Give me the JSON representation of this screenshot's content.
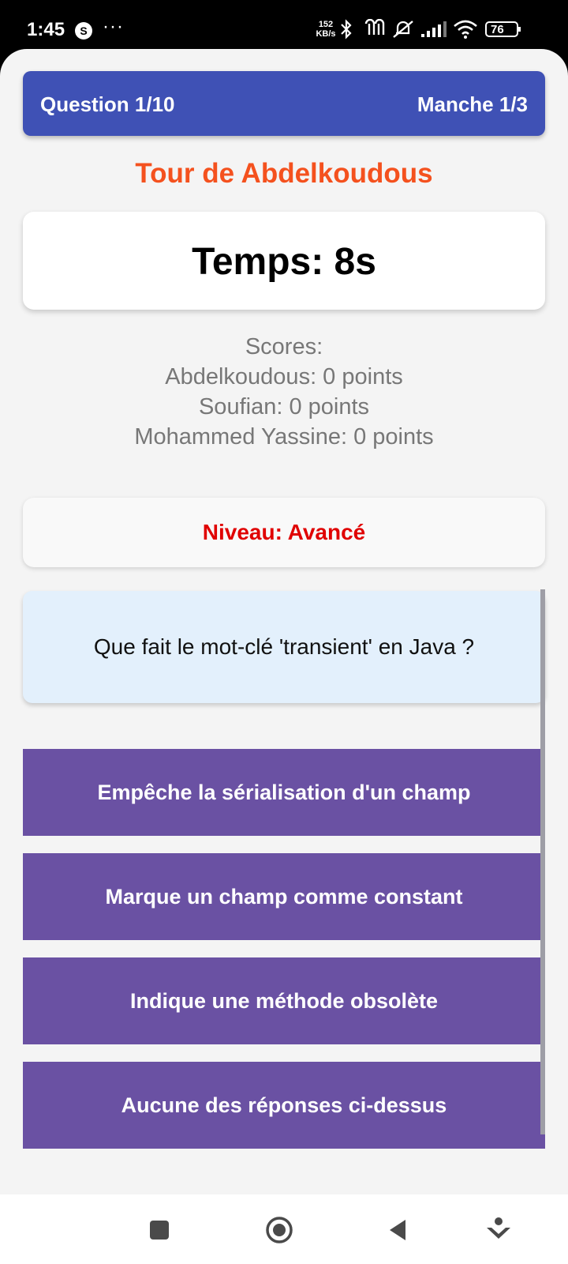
{
  "status_bar": {
    "time": "1:45",
    "app_icon_letter": "S",
    "more": "···",
    "net_speed_value": "152",
    "net_speed_unit": "KB/s",
    "battery": "76"
  },
  "header": {
    "question_counter": "Question 1/10",
    "round_counter": "Manche 1/3",
    "color": "#3f51b5"
  },
  "turn": {
    "title": "Tour de Abdelkoudous",
    "color": "#f4511e"
  },
  "timer": {
    "text": "Temps: 8s"
  },
  "scores": {
    "heading": "Scores:",
    "players": [
      "Abdelkoudous: 0 points",
      "Soufian: 0 points",
      "Mohammed Yassine: 0 points"
    ]
  },
  "level": {
    "text": "Niveau: Avancé",
    "color": "#e00000"
  },
  "question": {
    "text": "Que fait le mot-clé 'transient' en Java ?"
  },
  "answers": [
    "Empêche la sérialisation d'un champ",
    "Marque un champ comme constant",
    "Indique une méthode obsolète",
    "Aucune des réponses ci-dessus"
  ],
  "answer_color": "#6a51a3",
  "nav_bar": {
    "icons": [
      "recents-square-icon",
      "home-circle-icon",
      "back-triangle-icon",
      "assistant-icon"
    ]
  }
}
